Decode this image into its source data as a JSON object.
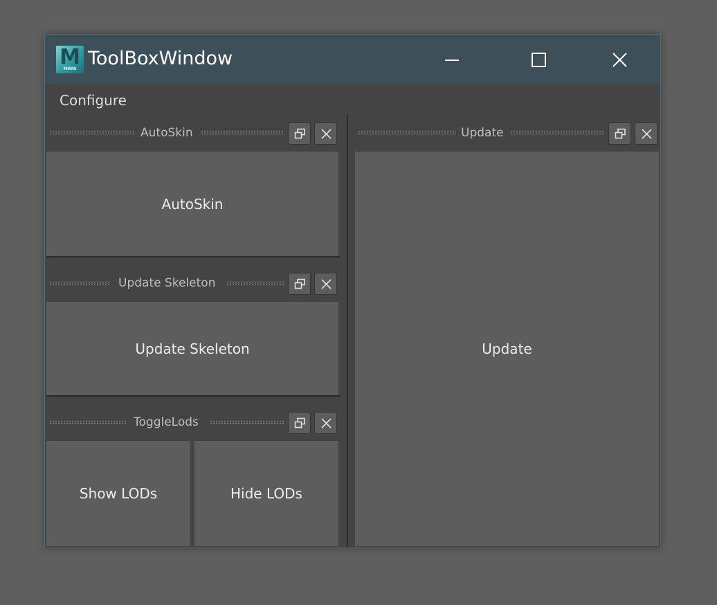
{
  "window": {
    "title": "ToolBoxWindow",
    "app_logo": {
      "letter": "M",
      "caption": "MAYA",
      "color": "#2e9ba1"
    },
    "titlebar_color": "#3d5059",
    "controls": {
      "minimize": "minimize-icon",
      "maximize": "maximize-icon",
      "close": "close-icon"
    }
  },
  "menubar": {
    "items": [
      {
        "label": "Configure"
      }
    ]
  },
  "panels": {
    "autoskin": {
      "title": "AutoSkin",
      "button": "AutoSkin"
    },
    "update_skeleton": {
      "title": "Update Skeleton",
      "button": "Update Skeleton"
    },
    "togglelods": {
      "title": "ToggleLods",
      "buttons": [
        "Show LODs",
        "Hide LODs"
      ]
    },
    "update": {
      "title": "Update",
      "button": "Update"
    }
  },
  "colors": {
    "background": "#5f5f5f",
    "panel": "#444444",
    "button": "#5d5d5d",
    "text": "#ececec"
  }
}
